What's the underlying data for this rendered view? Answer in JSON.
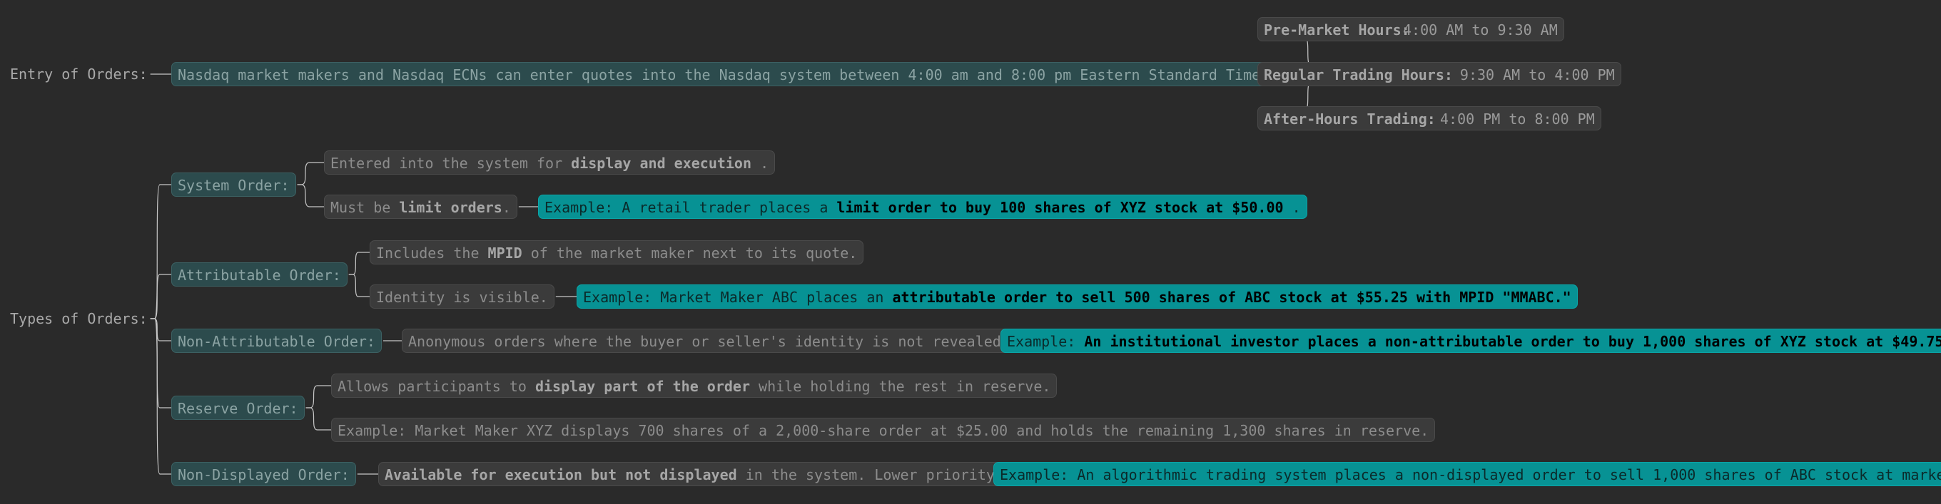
{
  "entry": {
    "label": "Entry of Orders:",
    "description": "Nasdaq market makers and Nasdaq ECNs can enter quotes into the Nasdaq system between 4:00 am and 8:00 pm Eastern Standard Time (ET).",
    "sessions": [
      {
        "name": "Pre-Market Hours:",
        "time": "4:00 AM to 9:30 AM"
      },
      {
        "name": "Regular Trading Hours:",
        "time": "9:30 AM to 4:00 PM"
      },
      {
        "name": "After-Hours Trading:",
        "time": "4:00 PM to 8:00 PM"
      }
    ]
  },
  "types": {
    "label": "Types of Orders:",
    "system": {
      "label": "System Order:",
      "d1_a": "Entered into the system for ",
      "d1_b": "display and execution",
      "d1_c": " .",
      "d2_a": "Must be ",
      "d2_b": "limit orders",
      "d2_c": ".",
      "ex_a": "Example: A retail trader places a ",
      "ex_b": "limit order to buy 100 shares of XYZ stock at $50.00",
      "ex_c": " ."
    },
    "attributable": {
      "label": "Attributable Order:",
      "d1_a": "Includes the ",
      "d1_b": "MPID",
      "d1_c": " of the market maker next to its quote.",
      "d2": "Identity is visible.",
      "ex_a": "Example: Market Maker ABC places an ",
      "ex_b": "attributable order to sell 500 shares of ABC stock at $55.25 with MPID \"MMABC.\""
    },
    "non_attributable": {
      "label": "Non-Attributable Order:",
      "d1": "Anonymous orders where the buyer or seller's identity is not revealed.",
      "ex_a": "Example: ",
      "ex_b": "An institutional investor places a non-attributable order to buy 1,000 shares of XYZ stock at $49.75",
      "ex_c": " ."
    },
    "reserve": {
      "label": "Reserve Order:",
      "d1_a": "Allows participants to ",
      "d1_b": "display part of the order",
      "d1_c": " while holding the rest in reserve.",
      "d2": "Example: Market Maker XYZ displays 700 shares of a 2,000-share order at $25.00 and holds the remaining 1,300 shares in reserve."
    },
    "non_displayed": {
      "label": "Non-Displayed Order:",
      "d1_a": "Available for execution but not displayed",
      "d1_b": " in the system. Lower priority.",
      "ex": "Example: An algorithmic trading system places a non-displayed order to sell 1,000 shares of ABC stock at market price."
    }
  }
}
